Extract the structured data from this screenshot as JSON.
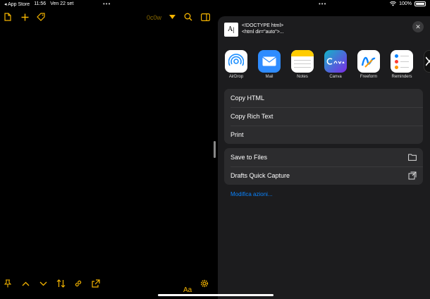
{
  "status_bar": {
    "back_label": "◂ App Store",
    "time": "11:56",
    "date": "Ven 22 set",
    "battery_percent": "100%"
  },
  "editor": {
    "draft_name": "0c0w",
    "font_button_label": "Aa",
    "accent_color": "#f4b400",
    "top_icons": [
      "new-draft-icon",
      "plus-icon",
      "tag-icon",
      "dropdown-caret-icon",
      "search-icon",
      "sidebar-icon"
    ],
    "bottom_icons": [
      "pin-icon",
      "chevron-up-icon",
      "chevron-down-icon",
      "reorder-arrows-icon",
      "link-icon",
      "share-icon",
      "gear-icon"
    ]
  },
  "share_sheet": {
    "preview_line1": "<!DOCTYPE html>",
    "preview_line2": "<html dir=\"auto\">...",
    "apps": [
      {
        "label": "AirDrop",
        "icon": "airdrop-icon",
        "color": "#1e90ff"
      },
      {
        "label": "Mail",
        "icon": "mail-icon",
        "color": "#2f8cff"
      },
      {
        "label": "Notes",
        "icon": "notes-icon",
        "color": "#ffffff"
      },
      {
        "label": "Canva",
        "icon": "canva-icon",
        "color": "#13b5c7"
      },
      {
        "label": "Freeform",
        "icon": "freeform-icon",
        "color": "#ffffff"
      },
      {
        "label": "Reminders",
        "icon": "reminders-icon",
        "color": "#ffffff"
      }
    ],
    "actions_group1": [
      "Copy HTML",
      "Copy Rich Text",
      "Print"
    ],
    "actions_group2": [
      {
        "label": "Save to Files",
        "icon": "folder-icon"
      },
      {
        "label": "Drafts Quick Capture",
        "icon": "capture-icon"
      }
    ],
    "edit_actions_label": "Modifica azioni...",
    "link_color": "#0a84ff"
  }
}
